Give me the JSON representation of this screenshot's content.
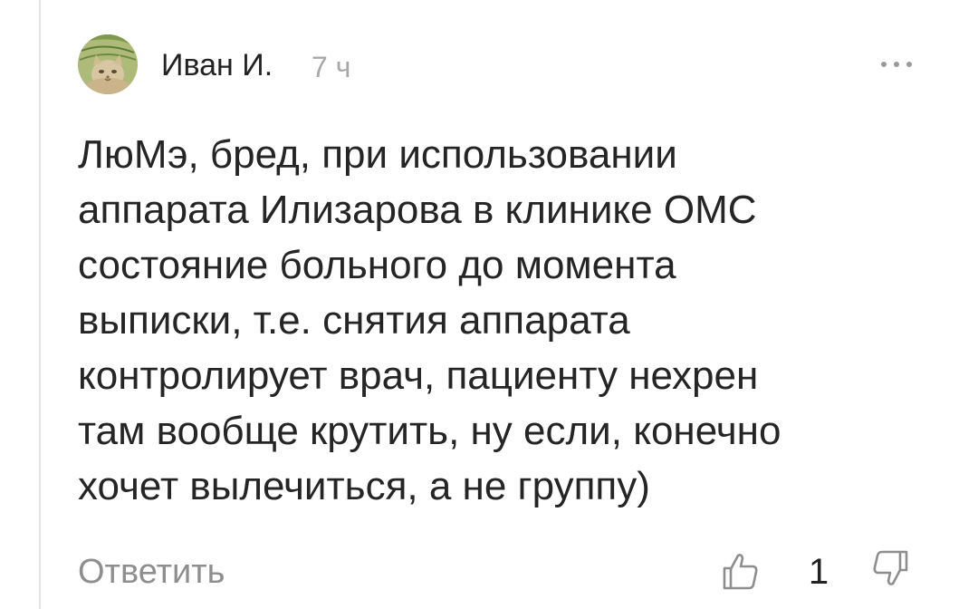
{
  "comment": {
    "author": "Иван И.",
    "time": "7 ч",
    "text": "ЛюМэ, бред, при использовании\nаппарата Илизарова в клинике ОМС\nсостояние больного до момента\nвыписки, т.е. снятия аппарата\nконтролирует врач, пациенту нехрен\nтам вообще крутить, ну если, конечно\nхочет вылечиться, а не группу)",
    "reply_label": "Ответить",
    "rating": "1"
  },
  "icons": {
    "more": "more-dots-icon",
    "like": "thumb-up-icon",
    "dislike": "thumb-down-icon"
  },
  "colors": {
    "author": "#222222",
    "meta": "#a8a8a8",
    "reply": "#8e8e8e",
    "icon": "#8e8e8e"
  }
}
